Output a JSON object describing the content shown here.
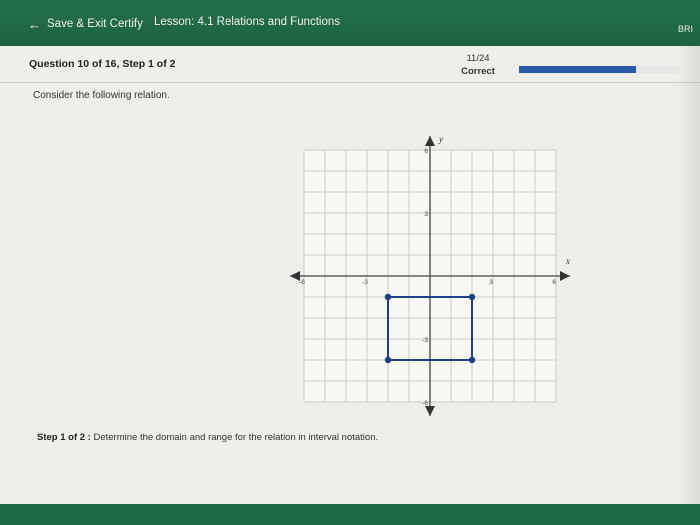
{
  "header": {
    "exit_label": "Save & Exit Certify",
    "lesson_title": "Lesson: 4.1 Relations and Functions",
    "right_cut_label": "BRI"
  },
  "question": {
    "label": "Question 10 of 16, Step 1 of 2",
    "score": "11/24",
    "status": "Correct",
    "progress_fraction": 0.73,
    "prompt": "Consider the following relation."
  },
  "graph": {
    "x_axis_label": "x",
    "y_axis_label": "y",
    "x_ticks": [
      "-6",
      "-3",
      "3",
      "6"
    ],
    "y_ticks": [
      "6",
      "3",
      "-3",
      "-6"
    ],
    "x_range": [
      -6,
      6
    ],
    "y_range": [
      -6,
      6
    ],
    "grid": true,
    "rectangle_vertices": [
      [
        -2,
        -1
      ],
      [
        2,
        -1
      ],
      [
        2,
        -4
      ],
      [
        -2,
        -4
      ]
    ]
  },
  "step": {
    "prefix": "Step 1 of 2 :",
    "text": " Determine the domain and range for the relation in interval notation."
  },
  "colors": {
    "header_green": "#1e6b45",
    "progress_blue": "#2a5aa8",
    "relation_blue": "#1f3f87"
  }
}
